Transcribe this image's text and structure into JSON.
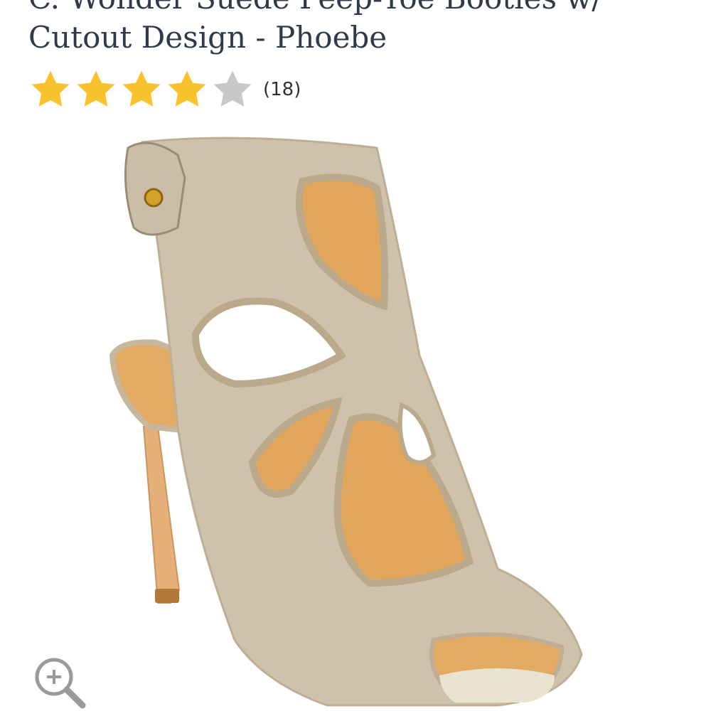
{
  "product": {
    "title_line_1": "C. Wonder Suede Peep-Toe Booties w/",
    "title_line_2": "Cutout Design - Phoebe",
    "image_alt": "Suede peep-toe bootie with cutout design"
  },
  "rating": {
    "value": 4,
    "max": 5,
    "review_count_text": "(18)"
  },
  "colors": {
    "star_filled": "#f7c22e",
    "star_empty": "#c8c8c8",
    "title_text": "#2f3a4a",
    "suede": "#cfc2ad",
    "lining": "#e2a55c",
    "zoom_icon": "#9a9a9a"
  },
  "icons": {
    "zoom": "zoom-in-icon"
  }
}
